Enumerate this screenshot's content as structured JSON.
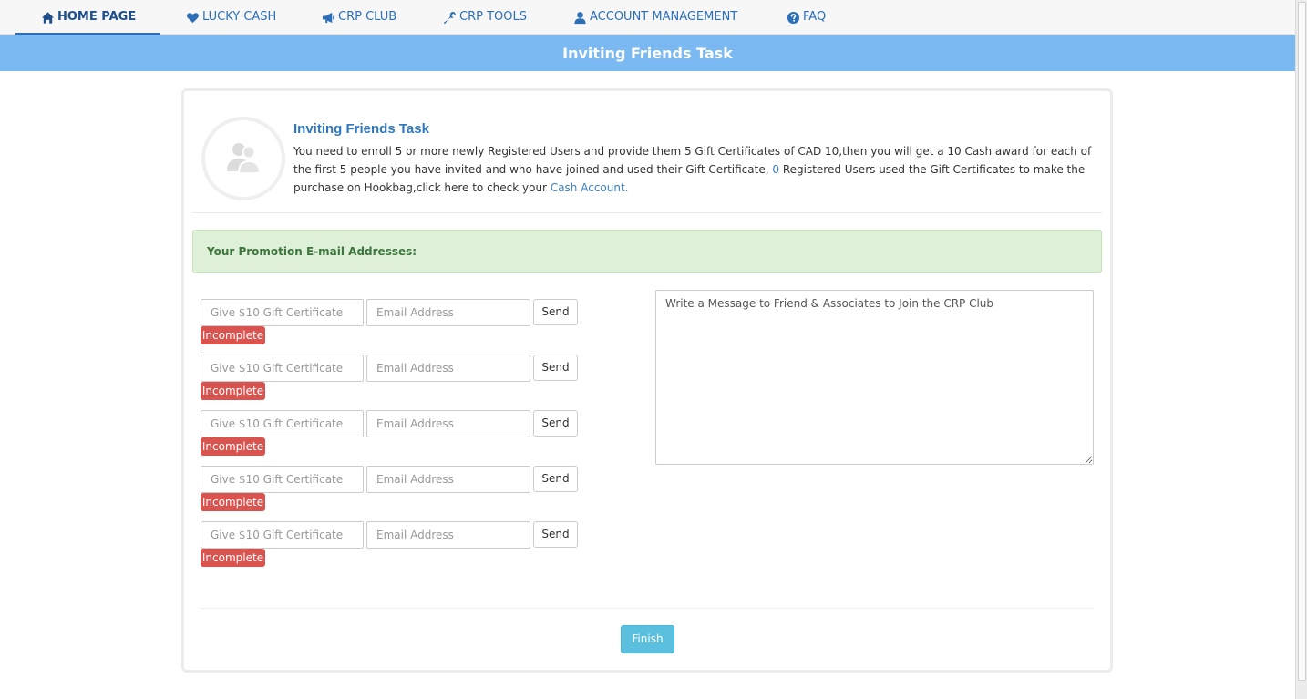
{
  "nav": {
    "items": [
      {
        "label": "HOME PAGE",
        "icon": "home-icon"
      },
      {
        "label": "LUCKY CASH",
        "icon": "heart-icon"
      },
      {
        "label": "CRP CLUB",
        "icon": "bullhorn-icon"
      },
      {
        "label": "CRP TOOLS",
        "icon": "wrench-icon"
      },
      {
        "label": "ACCOUNT MANAGEMENT",
        "icon": "user-icon"
      },
      {
        "label": "FAQ",
        "icon": "question-circle-icon"
      }
    ],
    "active_index": 0
  },
  "header": {
    "title": "Inviting Friends Task"
  },
  "intro": {
    "title": "Inviting Friends Task",
    "text_part1": "You need to enroll 5 or more newly Registered Users and provide them 5 Gift Certificates of CAD 10,then you will get a 10 Cash award for each of the first 5 people you have invited and who have joined and used their Gift Certificate, ",
    "registered_count": "0",
    "text_part2": " Registered Users used the Gift Certificates to make the purchase on Hookbag,click here to check your ",
    "cash_account_link": "Cash Account."
  },
  "promotion": {
    "heading": "Your Promotion E-mail Addresses:"
  },
  "rows": [
    {
      "gift_placeholder": "Give $10 Gift Certificate",
      "email_placeholder": "Email Address",
      "send_label": "Send",
      "status": "Incomplete"
    },
    {
      "gift_placeholder": "Give $10 Gift Certificate",
      "email_placeholder": "Email Address",
      "send_label": "Send",
      "status": "Incomplete"
    },
    {
      "gift_placeholder": "Give $10 Gift Certificate",
      "email_placeholder": "Email Address",
      "send_label": "Send",
      "status": "Incomplete"
    },
    {
      "gift_placeholder": "Give $10 Gift Certificate",
      "email_placeholder": "Email Address",
      "send_label": "Send",
      "status": "Incomplete"
    },
    {
      "gift_placeholder": "Give $10 Gift Certificate",
      "email_placeholder": "Email Address",
      "send_label": "Send",
      "status": "Incomplete"
    }
  ],
  "message": {
    "placeholder": "Write a Message to Friend & Associates to Join the CRP Club"
  },
  "actions": {
    "finish_label": "Finish"
  },
  "colors": {
    "nav_text": "#2c6fb7",
    "title_bar": "#7ab9f2",
    "alert_bg": "#dff0d8",
    "alert_text": "#3c763d",
    "badge_danger": "#d9534f",
    "finish_button": "#5bc0de",
    "link": "#3a7fc4"
  }
}
